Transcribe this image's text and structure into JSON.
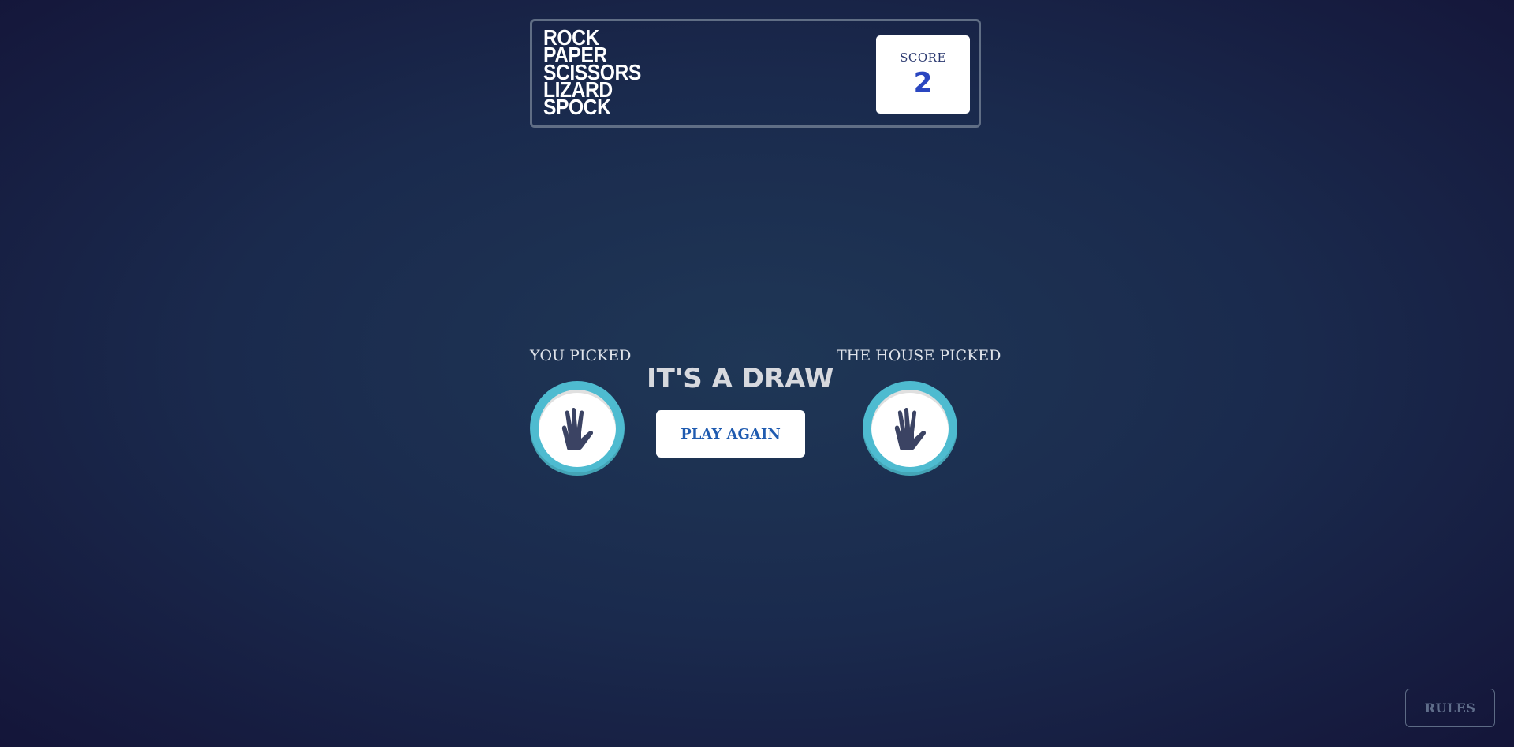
{
  "header": {
    "logo_lines": [
      "ROCK",
      "PAPER",
      "SCISSORS",
      "LIZARD",
      "SPOCK"
    ],
    "score_label": "SCORE",
    "score_value": "2"
  },
  "game": {
    "you_label": "YOU PICKED",
    "house_label": "THE HOUSE PICKED",
    "you_choice_icon": "spock-icon",
    "house_choice_icon": "spock-icon",
    "result_text": "IT'S A DRAW",
    "play_again_label": "PLAY AGAIN"
  },
  "footer": {
    "rules_label": "RULES"
  },
  "colors": {
    "spock_ring": "#4ebbd0",
    "score_value": "#2a46c0",
    "play_again_text": "#1f5bb0"
  }
}
